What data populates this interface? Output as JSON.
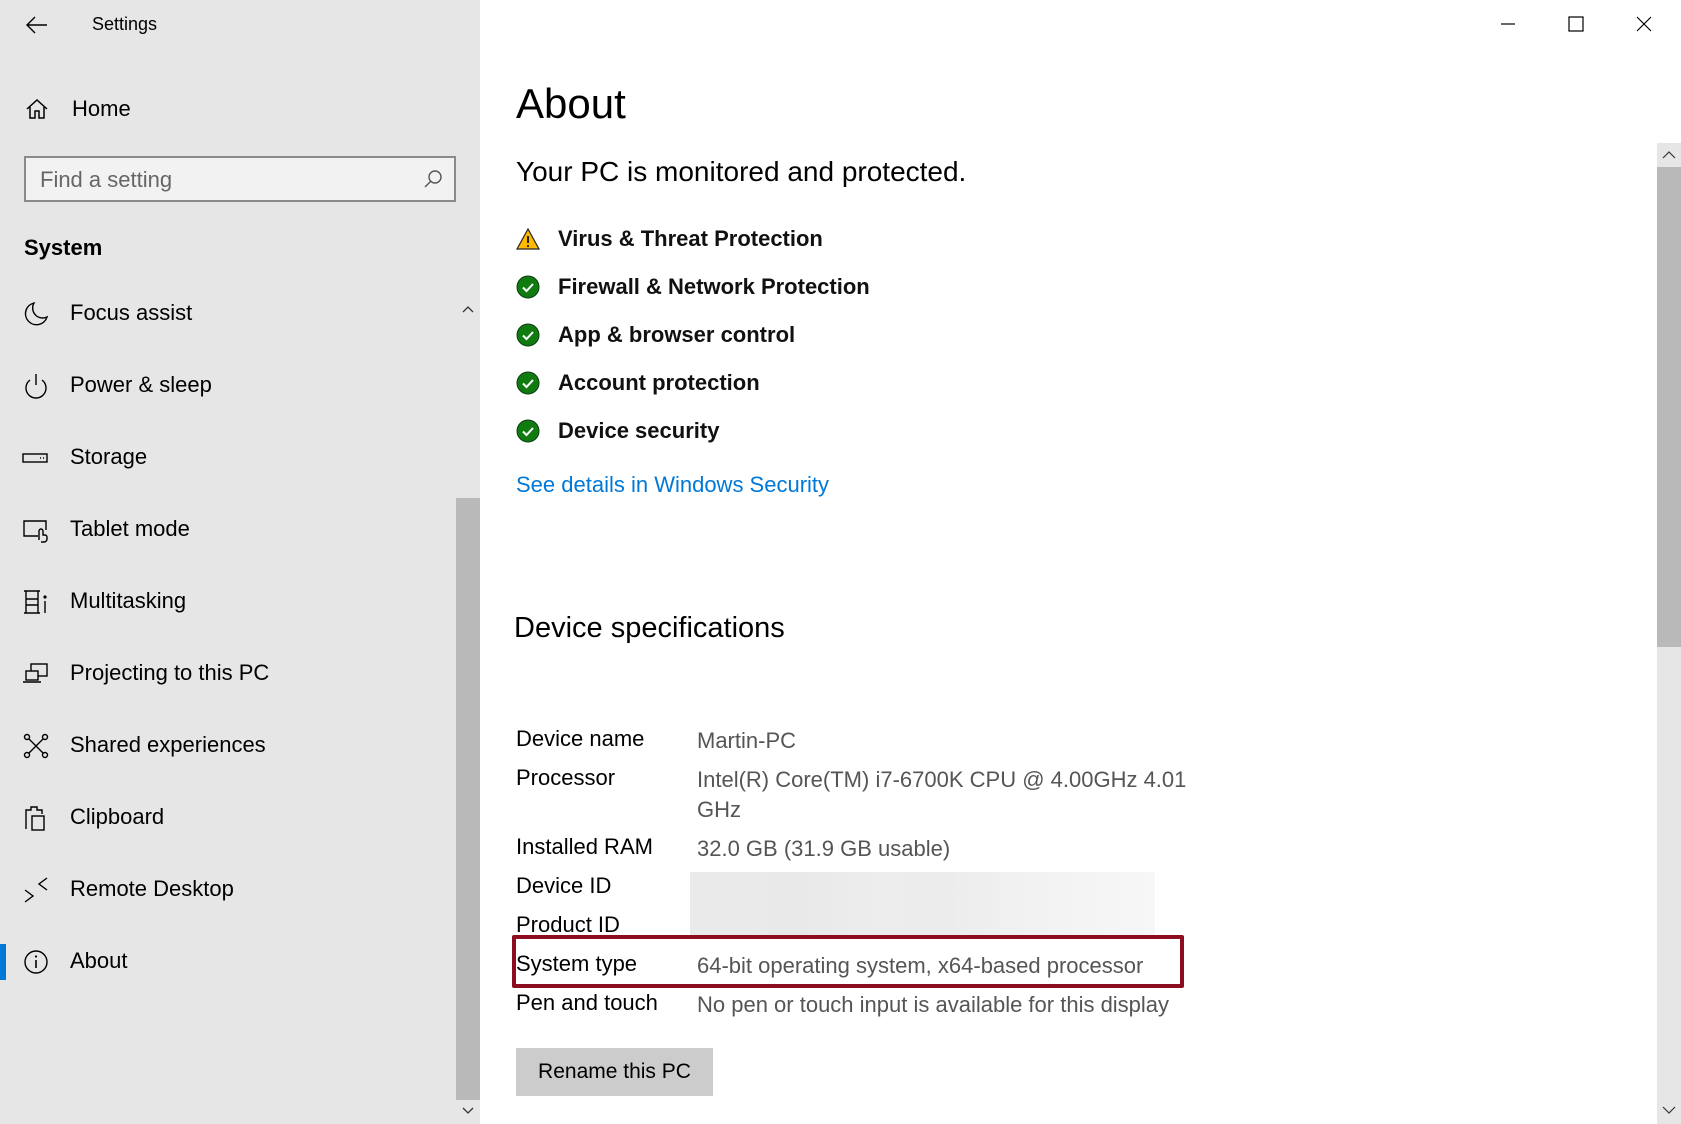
{
  "window": {
    "title": "Settings",
    "controls": {
      "minimize_icon": "minimize-icon",
      "maximize_icon": "maximize-icon",
      "close_icon": "close-icon"
    }
  },
  "sidebar": {
    "back_icon": "back-arrow-icon",
    "home": {
      "label": "Home",
      "icon": "home-icon"
    },
    "search": {
      "placeholder": "Find a setting",
      "value": "",
      "icon": "search-icon"
    },
    "section_title": "System",
    "items": [
      {
        "label": "Focus assist",
        "icon": "moon-icon",
        "selected": false
      },
      {
        "label": "Power & sleep",
        "icon": "power-icon",
        "selected": false
      },
      {
        "label": "Storage",
        "icon": "storage-icon",
        "selected": false
      },
      {
        "label": "Tablet mode",
        "icon": "tablet-mode-icon",
        "selected": false
      },
      {
        "label": "Multitasking",
        "icon": "multitasking-icon",
        "selected": false
      },
      {
        "label": "Projecting to this PC",
        "icon": "projecting-icon",
        "selected": false
      },
      {
        "label": "Shared experiences",
        "icon": "shared-experiences-icon",
        "selected": false
      },
      {
        "label": "Clipboard",
        "icon": "clipboard-icon",
        "selected": false
      },
      {
        "label": "Remote Desktop",
        "icon": "remote-desktop-icon",
        "selected": false
      },
      {
        "label": "About",
        "icon": "info-icon",
        "selected": true
      }
    ],
    "accent_color": "#0078d7"
  },
  "main": {
    "title": "About",
    "protection_status": "Your PC is monitored and protected.",
    "security_items": [
      {
        "label": "Virus & Threat Protection",
        "status": "warning",
        "icon": "warning-icon"
      },
      {
        "label": "Firewall & Network Protection",
        "status": "ok",
        "icon": "check-circle-icon"
      },
      {
        "label": "App & browser control",
        "status": "ok",
        "icon": "check-circle-icon"
      },
      {
        "label": "Account protection",
        "status": "ok",
        "icon": "check-circle-icon"
      },
      {
        "label": "Device security",
        "status": "ok",
        "icon": "check-circle-icon"
      }
    ],
    "security_link": "See details in Windows Security",
    "specs_title": "Device specifications",
    "specs": [
      {
        "key": "Device name",
        "value": "Martin-PC"
      },
      {
        "key": "Processor",
        "value": "Intel(R) Core(TM) i7-6700K CPU @ 4.00GHz   4.01 GHz"
      },
      {
        "key": "Installed RAM",
        "value": "32.0 GB (31.9 GB usable)"
      },
      {
        "key": "Device ID",
        "value": ""
      },
      {
        "key": "Product ID",
        "value": ""
      },
      {
        "key": "System type",
        "value": "64-bit operating system, x64-based processor",
        "highlighted": true
      },
      {
        "key": "Pen and touch",
        "value": "No pen or touch input is available for this display"
      }
    ],
    "rename_button": "Rename this PC"
  },
  "colors": {
    "link": "#0078d7",
    "highlight_box": "#8b0d1f",
    "ok_green": "#107c10",
    "warning_yellow": "#ffb900"
  }
}
